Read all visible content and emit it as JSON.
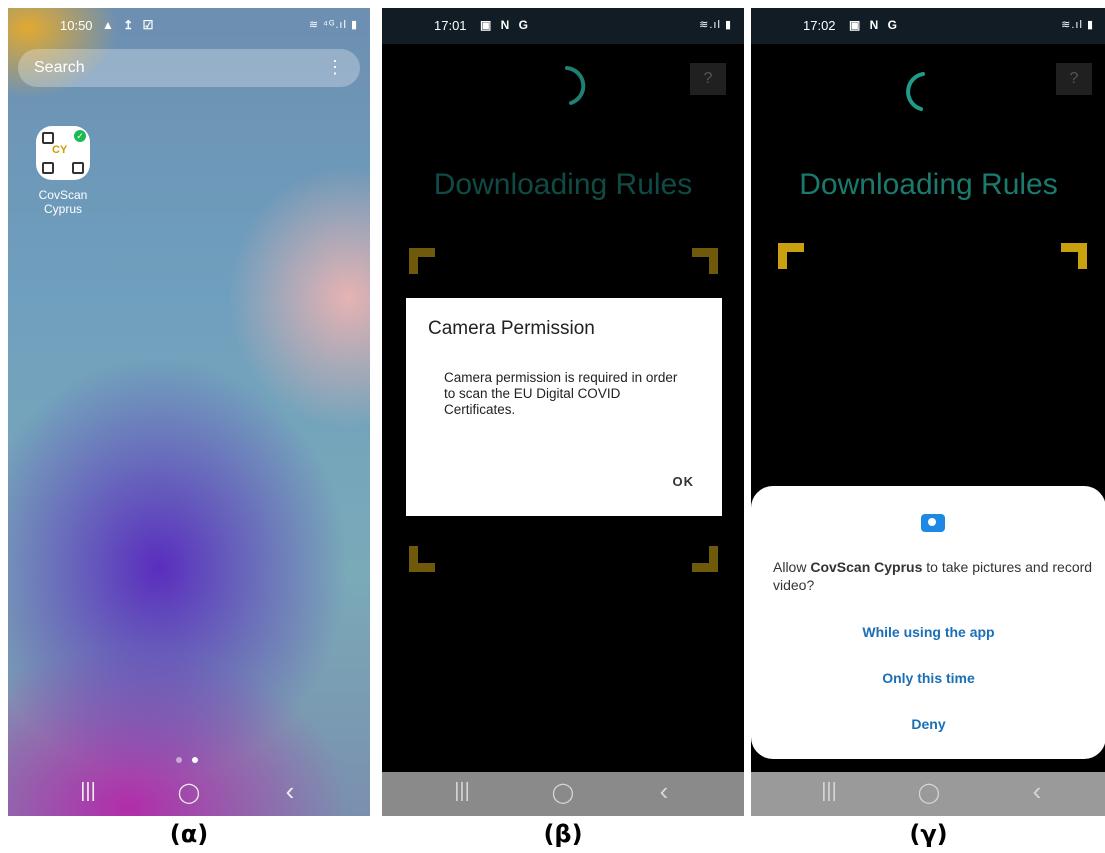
{
  "panels": [
    {
      "status": {
        "time": "10:50",
        "extra": "▲ ↥ ☑",
        "sysicons": "≋ ⁴ᴳ.ıl ▮"
      },
      "search": {
        "placeholder": "Search",
        "menu": "⋮"
      },
      "app": {
        "name_line1": "CovScan",
        "name_line2": "Cyprus",
        "icon_text": "CY"
      },
      "nav": {
        "recent": "|||",
        "home": "◯",
        "back": "‹"
      },
      "caption": "(α)"
    },
    {
      "status": {
        "time": "17:01",
        "extra": "▣ N G",
        "sysicons": "≋.ıl ▮"
      },
      "help": "?",
      "loading_text": "Downloading Rules",
      "dialog": {
        "title": "Camera Permission",
        "message": "Camera permission is required in order to scan the EU Digital COVID Certificates.",
        "ok": "OK"
      },
      "nav": {
        "recent": "|||",
        "home": "◯",
        "back": "‹"
      },
      "caption": "(β)"
    },
    {
      "status": {
        "time": "17:02",
        "extra": "▣ N G",
        "sysicons": "≋.ıl ▮"
      },
      "help": "?",
      "loading_text": "Downloading Rules",
      "permission": {
        "msg_prefix": "Allow ",
        "app_name": "CovScan Cyprus",
        "msg_suffix": " to take pictures and record video?",
        "option1": "While using the app",
        "option2": "Only this time",
        "option3": "Deny"
      },
      "nav": {
        "recent": "|||",
        "home": "◯",
        "back": "‹"
      },
      "caption": "(γ)"
    }
  ],
  "colors": {
    "accent_teal": "#16625a",
    "spinner_teal": "#1f9c8a",
    "corner_yellow": "#c9a010",
    "corner_dim": "#6e5a0a",
    "link_blue": "#1a6fb5"
  }
}
